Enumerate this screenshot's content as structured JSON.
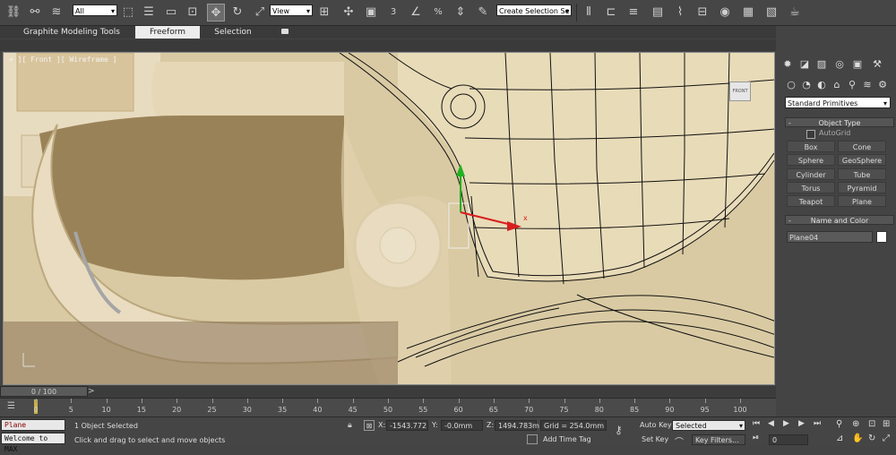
{
  "toolbar": {
    "selection_filter": "All",
    "reference_coord": "View",
    "named_selection": "Create Selection Se",
    "snap_label": "3",
    "percent_label": "%"
  },
  "ribbon": {
    "tabs": [
      "Graphite Modeling Tools",
      "Freeform",
      "Selection"
    ],
    "active_tab": "Freeform"
  },
  "viewport": {
    "label": "+ ][ Front ][ Wireframe ]",
    "viewcube_label": "FRONT"
  },
  "command_panel": {
    "category": "Standard Primitives",
    "object_type": {
      "title": "Object Type",
      "autogrid": "AutoGrid",
      "buttons": [
        "Box",
        "Cone",
        "Sphere",
        "GeoSphere",
        "Cylinder",
        "Tube",
        "Torus",
        "Pyramid",
        "Teapot",
        "Plane"
      ]
    },
    "name_color": {
      "title": "Name and Color",
      "name": "Plane04",
      "color": "#ffffff"
    }
  },
  "timeline": {
    "slider": "0 / 100",
    "ticks": [
      "0",
      "5",
      "10",
      "15",
      "20",
      "25",
      "30",
      "35",
      "40",
      "45",
      "50",
      "55",
      "60",
      "65",
      "70",
      "75",
      "80",
      "85",
      "90",
      "95",
      "100"
    ]
  },
  "status": {
    "script_line1": "Plane realWorl",
    "script_line2": "Welcome to MAX",
    "selection_info": "1 Object Selected",
    "prompt": "Click and drag to select and move objects",
    "x_label": "X:",
    "x_value": "-1543.772",
    "y_label": "Y:",
    "y_value": "-0.0mm",
    "z_label": "Z:",
    "z_value": "1494.783m",
    "grid": "Grid = 254.0mm",
    "add_time_tag": "Add Time Tag",
    "auto_key": "Auto Key",
    "set_key": "Set Key",
    "key_mode": "Selected",
    "key_filters": "Key Filters...",
    "frame": "0"
  },
  "colors": {
    "toolbar_bg": "#464646",
    "active_tab_bg": "#ececec",
    "gizmo_x": "#d81e1e",
    "gizmo_y": "#21b021",
    "accent_cyan": "#52c7d8"
  }
}
